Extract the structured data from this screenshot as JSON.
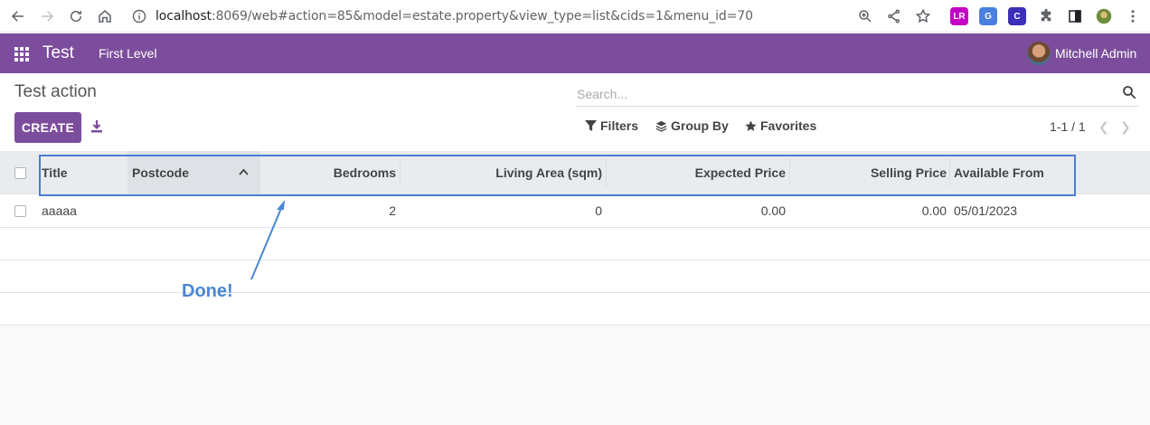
{
  "browser": {
    "url_host": "localhost",
    "url_path": ":8069/web#action=85&model=estate.property&view_type=list&cids=1&menu_id=70",
    "extensions": [
      {
        "name": "lr-extension",
        "label": "LR",
        "color": "#c400c4"
      },
      {
        "name": "translate-extension",
        "label": "G",
        "color": "#4a7fe0"
      },
      {
        "name": "c-extension",
        "label": "C",
        "color": "#3b2fb8"
      }
    ]
  },
  "navbar": {
    "app_name": "Test",
    "menu_item": "First Level",
    "user_name": "Mitchell Admin"
  },
  "control_panel": {
    "breadcrumb": "Test action",
    "search_placeholder": "Search...",
    "create_label": "CREATE",
    "filters_label": "Filters",
    "group_by_label": "Group By",
    "favorites_label": "Favorites",
    "pager": "1-1 / 1"
  },
  "list": {
    "columns": [
      {
        "label": "Title"
      },
      {
        "label": "Postcode"
      },
      {
        "label": "Bedrooms"
      },
      {
        "label": "Living Area (sqm)"
      },
      {
        "label": "Expected Price"
      },
      {
        "label": "Selling Price"
      },
      {
        "label": "Available From"
      }
    ],
    "rows": [
      {
        "title": "aaaaa",
        "postcode": "",
        "bedrooms": "2",
        "living_area": "0",
        "expected_price": "0.00",
        "selling_price": "0.00",
        "available_from": "05/01/2023"
      }
    ]
  },
  "annotation": {
    "text": "Done!",
    "color": "#4a86d4"
  },
  "colors": {
    "brand": "#7c4d9c",
    "highlight": "#4a7fd0"
  }
}
